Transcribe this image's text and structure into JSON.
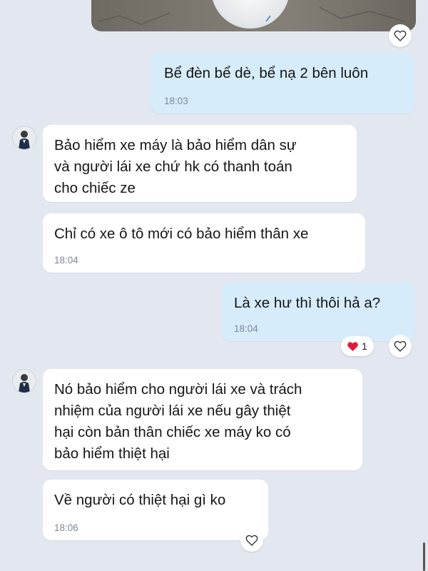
{
  "messages": [
    {
      "id": "m1",
      "text": "Bể đèn bể dè, bể nạ 2 bên luôn",
      "time": "18:03"
    },
    {
      "id": "m2",
      "text": "Bảo hiểm xe máy là bảo hiểm dân sự\nvà người lái xe chứ hk có thanh toán\ncho chiếc ze"
    },
    {
      "id": "m3",
      "text": "Chỉ có xe ô tô mới có bảo hiểm thân xe",
      "time": "18:04"
    },
    {
      "id": "m4",
      "text": "Là xe hư thì thôi hả a?",
      "time": "18:04",
      "reaction": {
        "icon": "heart-icon",
        "count": "1"
      }
    },
    {
      "id": "m5",
      "text": "Nó bảo hiểm cho người lái xe và trách\nnhiệm của người lái xe nếu gây thiệt\nhại còn bản thân chiếc xe máy ko có\nbảo hiểm thiệt hại"
    },
    {
      "id": "m6",
      "text": "Về người có thiệt hại gì ko",
      "time": "18:06"
    }
  ],
  "colors": {
    "incoming": "#ffffff",
    "outgoing": "#d6ecfb",
    "background": "#e3e8f0",
    "heart": "#e0193a"
  }
}
